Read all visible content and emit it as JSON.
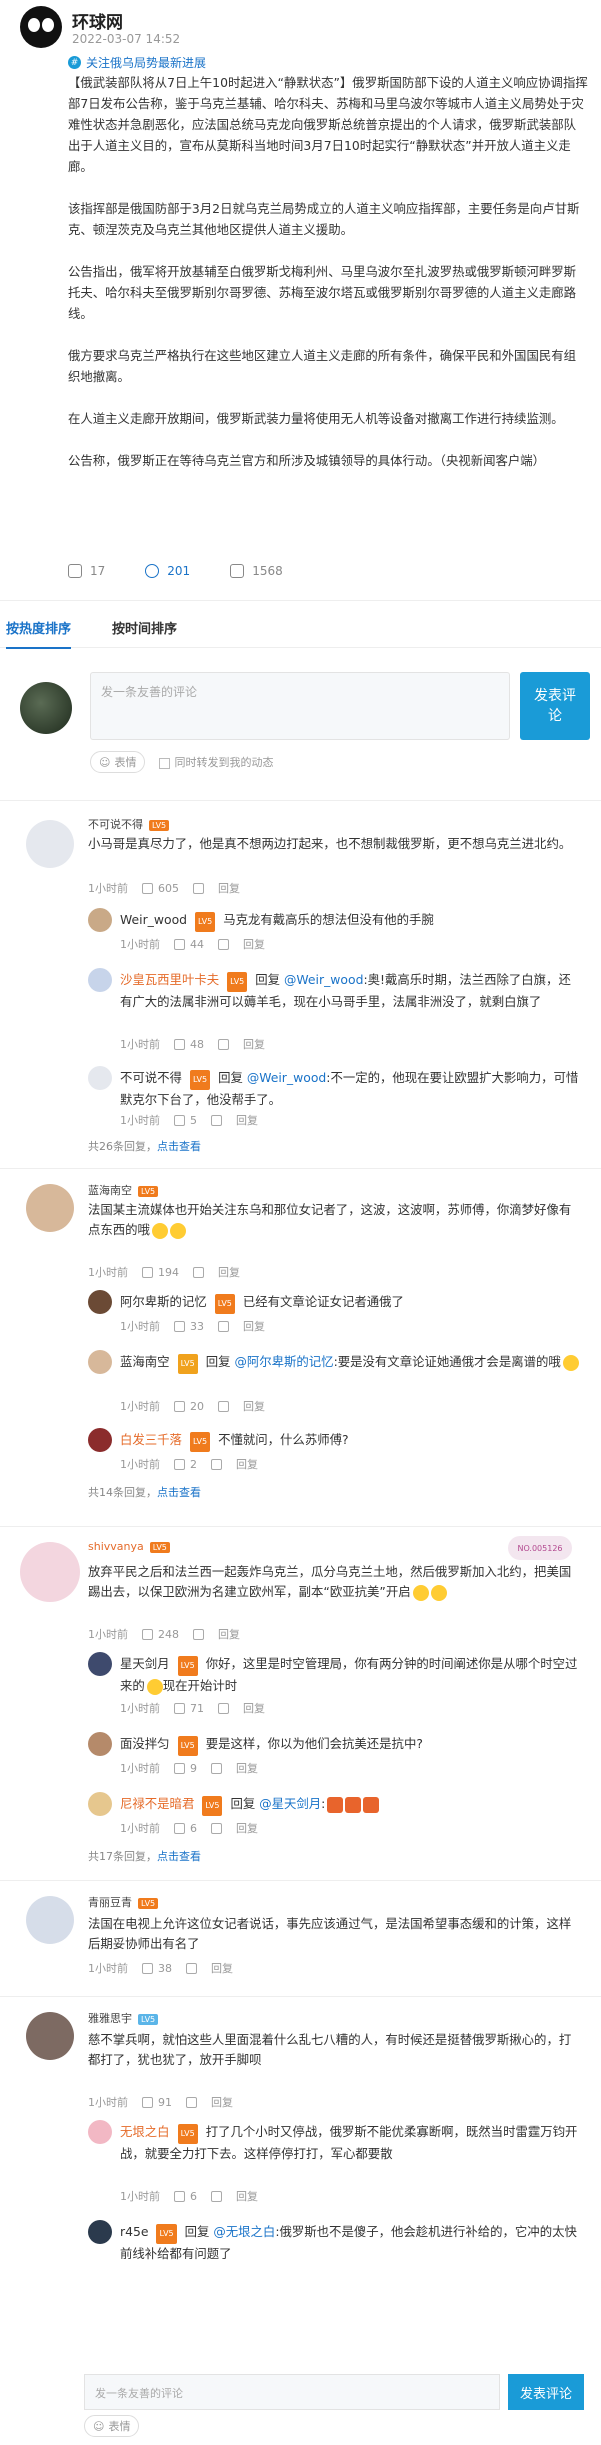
{
  "author": {
    "name": "环球网",
    "time": "2022-03-07 14:52"
  },
  "topic": "关注俄乌局势最新进展",
  "post_paragraphs": [
    "【俄武装部队将从7日上午10时起进入“静默状态”】俄罗斯国防部下设的人道主义响应协调指挥部7日发布公告称，鉴于乌克兰基辅、哈尔科夫、苏梅和马里乌波尔等城市人道主义局势处于灾难性状态并急剧恶化，应法国总统马克龙向俄罗斯总统普京提出的个人请求，俄罗斯武装部队出于人道主义目的，宣布从莫斯科当地时间3月7日10时起实行“静默状态”并开放人道主义走廊。",
    "该指挥部是俄国防部于3月2日就乌克兰局势成立的人道主义响应指挥部，主要任务是向卢甘斯克、顿涅茨克及乌克兰其他地区提供人道主义援助。",
    "公告指出，俄军将开放基辅至白俄罗斯戈梅利州、马里乌波尔至扎波罗热或俄罗斯顿河畔罗斯托夫、哈尔科夫至俄罗斯别尔哥罗德、苏梅至波尔塔瓦或俄罗斯别尔哥罗德的人道主义走廊路线。",
    "俄方要求乌克兰严格执行在这些地区建立人道主义走廊的所有条件，确保平民和外国国民有组织地撤离。",
    "在人道主义走廊开放期间，俄罗斯武装力量将使用无人机等设备对撤离工作进行持续监测。",
    "公告称，俄罗斯正在等待乌克兰官方和所涉及城镇领导的具体行动。（央视新闻客户端）"
  ],
  "actions": {
    "repost": "17",
    "comment": "201",
    "like": "1568"
  },
  "tabs": [
    "按热度排序",
    "按时间排序"
  ],
  "comment_box": {
    "placeholder": "发一条友善的评论",
    "submit": "发表评论",
    "emoji": "表情",
    "sync": "同时转发到我的动态"
  },
  "lv_label": "LV5",
  "reply_label": "回复",
  "threads": [
    {
      "user": "不可说不得",
      "text": "小马哥是真尽力了，他是真不想两边打起来，也不想制裁俄罗斯，更不想乌克兰进北约。",
      "time": "1小时前",
      "likes": "605",
      "replies": [
        {
          "user": "Weir_wood",
          "text": "马克龙有戴高乐的想法但没有他的手腕",
          "time": "1小时前",
          "likes": "44"
        },
        {
          "user": "沙皇瓦西里叶卡夫",
          "mention": "@Weir_wood",
          "text": ":奥!戴高乐时期，法兰西除了白旗，还有广大的法属非洲可以薅羊毛，现在小马哥手里，法属非洲没了，就剩白旗了",
          "time": "1小时前",
          "likes": "48"
        },
        {
          "user": "不可说不得",
          "mention": "@Weir_wood",
          "text": ":不一定的，他现在要让欧盟扩大影响力，可惜默克尔下台了，他没帮手了。",
          "time": "1小时前",
          "likes": "5"
        }
      ],
      "more_count": "共26条回复，",
      "more_link": "点击查看"
    },
    {
      "user": "蓝海南空",
      "text": "法国某主流媒体也开始关注东乌和那位女记者了，这波，这波啊，苏师傅，你滴梦好像有点东西的哦",
      "time": "1小时前",
      "likes": "194",
      "replies": [
        {
          "user": "阿尔卑斯的记忆",
          "text": "已经有文章论证女记者通俄了",
          "time": "1小时前",
          "likes": "33"
        },
        {
          "user": "蓝海南空",
          "mention": "@阿尔卑斯的记忆",
          "text": ":要是没有文章论证她通俄才会是离谱的哦",
          "time": "1小时前",
          "likes": "20"
        },
        {
          "user": "白发三千落",
          "text": "不懂就问，什么苏师傅?",
          "time": "1小时前",
          "likes": "2"
        }
      ],
      "more_count": "共14条回复，",
      "more_link": "点击查看"
    },
    {
      "user": "shivvanya",
      "badge": "NO.005126",
      "text": "放弃平民之后和法兰西一起轰炸乌克兰，瓜分乌克兰土地，然后俄罗斯加入北约，把美国踢出去，以保卫欧洲为名建立欧州军，副本“欧亚抗美”开启",
      "time": "1小时前",
      "likes": "248",
      "replies": [
        {
          "user": "星天剑月",
          "text": "你好，这里是时空管理局，你有两分钟的时间阐述你是从哪个时空过来的",
          "text2": "现在开始计时",
          "time": "1小时前",
          "likes": "71"
        },
        {
          "user": "面没拌匀",
          "text": "要是这样，你以为他们会抗美还是抗中?",
          "time": "1小时前",
          "likes": "9"
        },
        {
          "user": "尼禄不是暗君",
          "mention": "@星天剑月",
          "text": ":",
          "time": "1小时前",
          "likes": "6"
        }
      ],
      "more_count": "共17条回复，",
      "more_link": "点击查看"
    },
    {
      "user": "青丽豆青",
      "text": "法国在电视上允许这位女记者说话，事先应该通过气，是法国希望事态缓和的计策，这样后期妥协师出有名了",
      "time": "1小时前",
      "likes": "38",
      "replies": []
    },
    {
      "user": "雅雅思宇",
      "text": "慈不掌兵啊，就怕这些人里面混着什么乱七八糟的人，有时候还是挺替俄罗斯揪心的，打都打了，犹也犹了，放开手脚呗",
      "time": "1小时前",
      "likes": "91",
      "replies": [
        {
          "user": "无垠之白",
          "text": "打了几个小时又停战，俄罗斯不能优柔寡断啊，既然当时雷霆万钧开战，就要全力打下去。这样停停打打，军心都要散",
          "time": "1小时前",
          "likes": "6"
        },
        {
          "user": "r45e",
          "mention": "@无垠之白",
          "text": ":俄罗斯也不是傻子，他会趁机进行补给的，它冲的太快前线补给都有问题了",
          "time": "",
          "likes": ""
        }
      ]
    }
  ],
  "bottom_box": {
    "placeholder": "发一条友善的评论",
    "submit": "发表评论",
    "emoji": "表情"
  }
}
